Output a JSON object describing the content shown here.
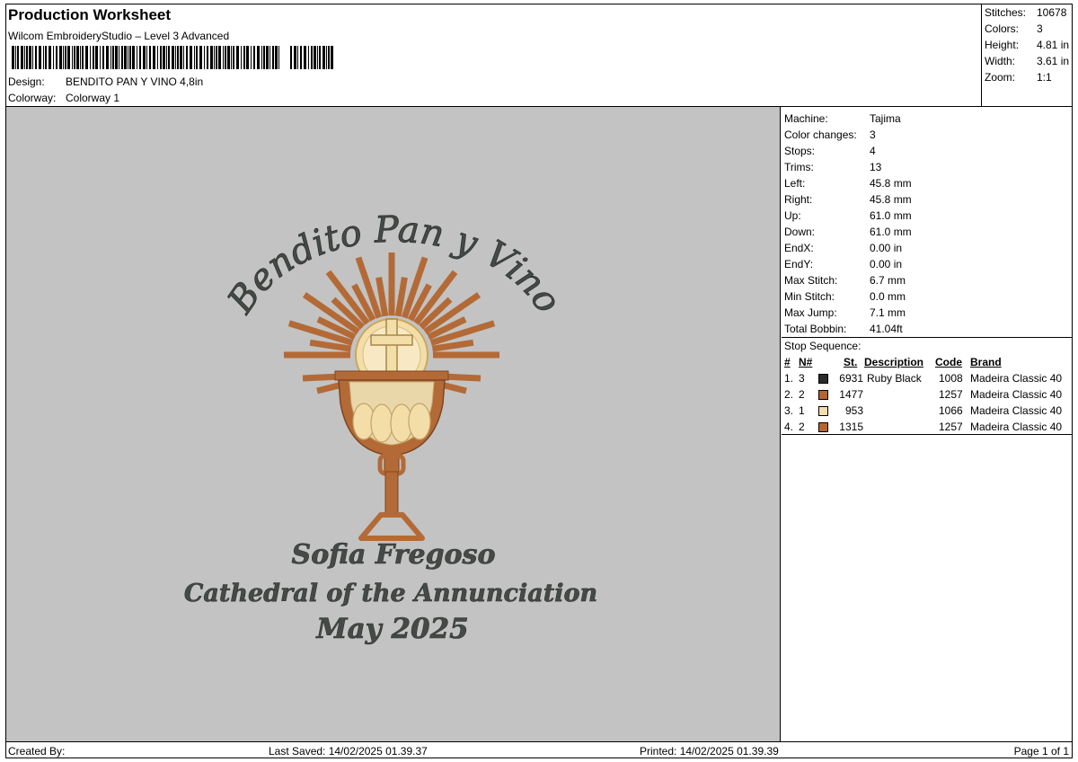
{
  "header": {
    "title": "Production Worksheet",
    "software": "Wilcom EmbroideryStudio – Level 3 Advanced",
    "design_label": "Design:",
    "design_value": "BENDITO PAN Y VINO 4,8in",
    "colorway_label": "Colorway:",
    "colorway_value": "Colorway 1"
  },
  "stats": [
    {
      "label": "Stitches:",
      "value": "10678"
    },
    {
      "label": "Colors:",
      "value": "3"
    },
    {
      "label": "Height:",
      "value": "4.81 in"
    },
    {
      "label": "Width:",
      "value": "3.61 in"
    },
    {
      "label": "Zoom:",
      "value": "1:1"
    }
  ],
  "machine_info": [
    {
      "label": "Machine:",
      "value": "Tajima"
    },
    {
      "label": "Color changes:",
      "value": "3"
    },
    {
      "label": "Stops:",
      "value": "4"
    },
    {
      "label": "Trims:",
      "value": "13"
    },
    {
      "label": "Left:",
      "value": "45.8 mm"
    },
    {
      "label": "Right:",
      "value": "45.8 mm"
    },
    {
      "label": "Up:",
      "value": "61.0 mm"
    },
    {
      "label": "Down:",
      "value": "61.0 mm"
    },
    {
      "label": "EndX:",
      "value": "0.00 in"
    },
    {
      "label": "EndY:",
      "value": "0.00 in"
    },
    {
      "label": "Max Stitch:",
      "value": "6.7 mm"
    },
    {
      "label": "Min Stitch:",
      "value": "0.0 mm"
    },
    {
      "label": "Max Jump:",
      "value": "7.1 mm"
    },
    {
      "label": "Total Bobbin:",
      "value": "41.04ft"
    }
  ],
  "stop_sequence": {
    "title": "Stop Sequence:",
    "columns": [
      "#",
      "N#",
      "St.",
      "Description",
      "Code",
      "Brand"
    ],
    "rows": [
      {
        "num": "1.",
        "n": "3",
        "color": "#2b2b2b",
        "st": "6931",
        "description": "Ruby Black",
        "code": "1008",
        "brand": "Madeira Classic 40"
      },
      {
        "num": "2.",
        "n": "2",
        "color": "#b5652f",
        "st": "1477",
        "description": "",
        "code": "1257",
        "brand": "Madeira Classic 40"
      },
      {
        "num": "3.",
        "n": "1",
        "color": "#f5dcae",
        "st": "953",
        "description": "",
        "code": "1066",
        "brand": "Madeira Classic 40"
      },
      {
        "num": "4.",
        "n": "2",
        "color": "#b5652f",
        "st": "1315",
        "description": "",
        "code": "1257",
        "brand": "Madeira Classic 40"
      }
    ]
  },
  "design": {
    "arc_text": "Bendito Pan y Vino",
    "line1": "Sofia Fregoso",
    "line2": "Cathedral of the Annunciation",
    "line3": "May 2025",
    "colors": {
      "canvas": "#c3c3c3",
      "thread_dark": "#454a46",
      "thread_copper": "#b46a36",
      "thread_cream": "#f3dea9"
    }
  },
  "footer": {
    "created_by": "Created By:",
    "last_saved": "Last Saved: 14/02/2025 01.39.37",
    "printed": "Printed: 14/02/2025 01.39.39",
    "page": "Page 1 of 1"
  }
}
